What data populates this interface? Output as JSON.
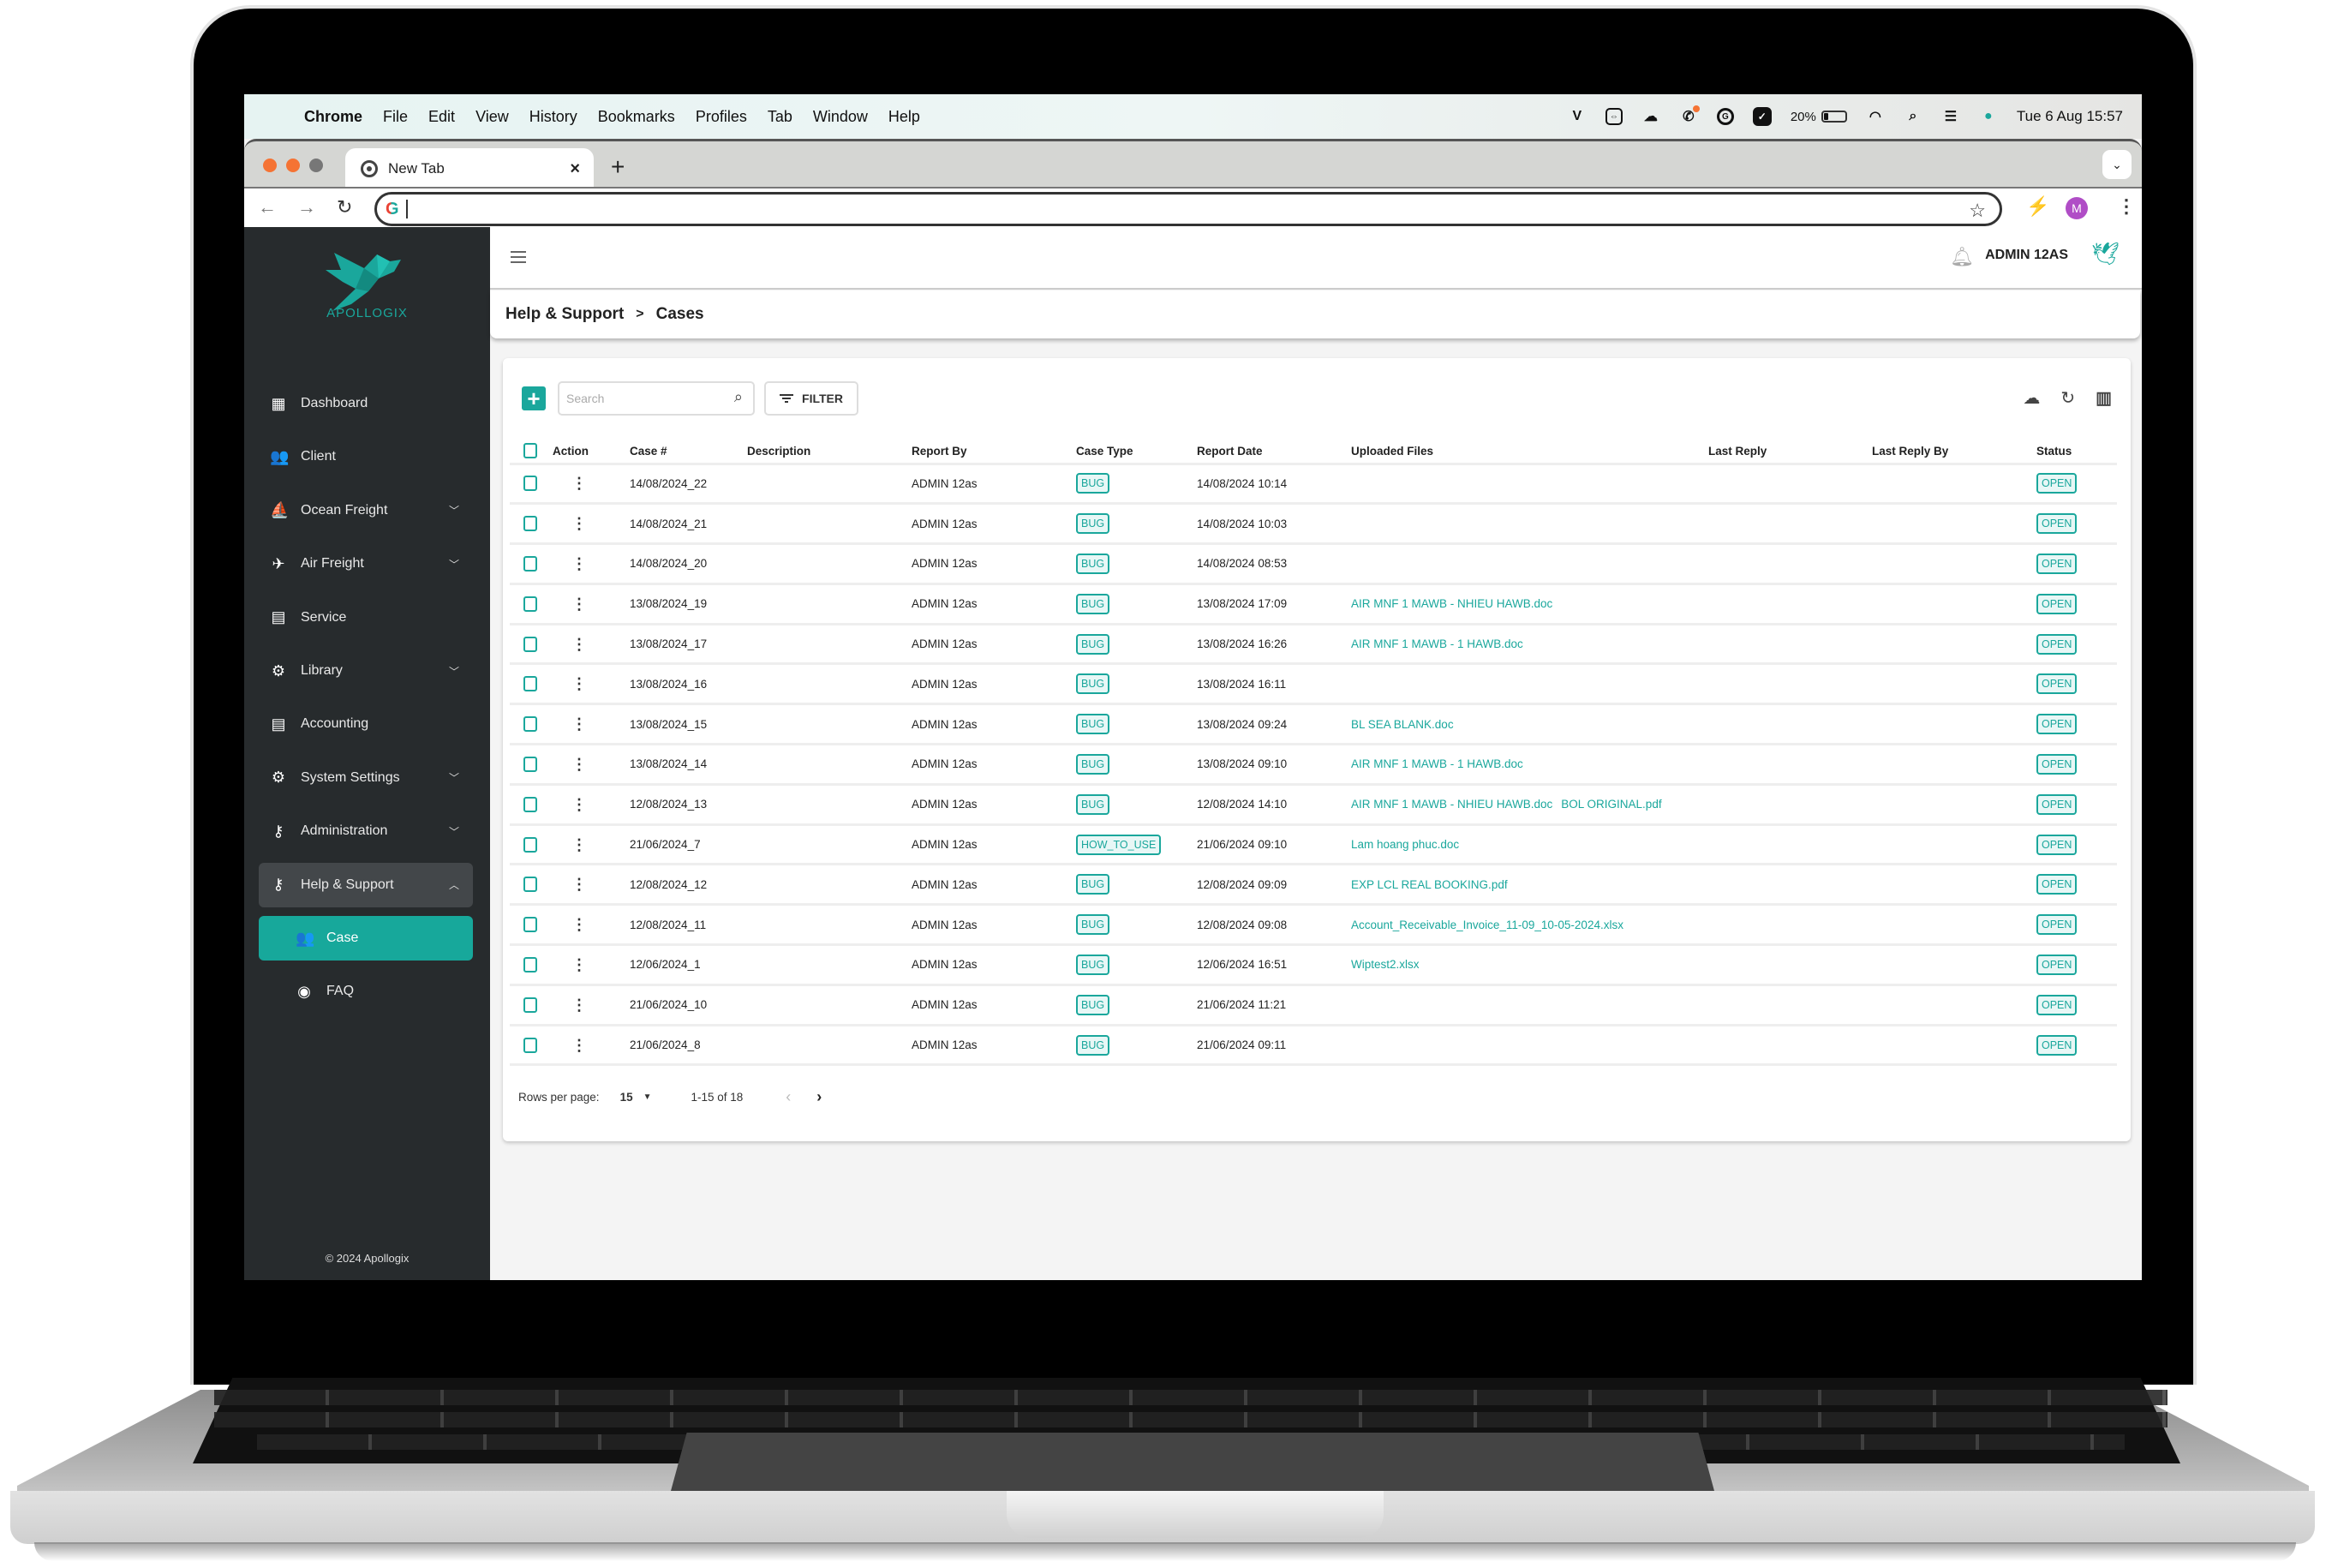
{
  "os_menubar": {
    "app": "Chrome",
    "items": [
      "File",
      "Edit",
      "View",
      "History",
      "Bookmarks",
      "Profiles",
      "Tab",
      "Window",
      "Help"
    ],
    "status_icons": [
      "vivaldi-icon",
      "teamviewer-icon",
      "cloud-sync-icon",
      "phone-notification-icon",
      "grammarly-icon",
      "checkbox-app-icon"
    ],
    "battery_percent": "20%",
    "battery_level": 0.2,
    "datetime": "Tue 6 Aug  15:57"
  },
  "browser": {
    "tab_title": "New Tab",
    "address_value": "",
    "profile_initial": "M",
    "colors": {
      "close": "#f57334",
      "minimize": "#f57334",
      "maximize": "#777777",
      "profile": "#b04dc6"
    }
  },
  "sidebar": {
    "brand": "APOLLOGIX",
    "items": [
      {
        "label": "Dashboard",
        "icon": "dashboard-icon",
        "glyph": "▦",
        "expandable": false
      },
      {
        "label": "Client",
        "icon": "people-icon",
        "glyph": "👥",
        "expandable": false
      },
      {
        "label": "Ocean Freight",
        "icon": "sailboat-icon",
        "glyph": "⛵",
        "expandable": true
      },
      {
        "label": "Air Freight",
        "icon": "airplane-icon",
        "glyph": "✈",
        "expandable": true
      },
      {
        "label": "Service",
        "icon": "list-icon",
        "glyph": "▤",
        "expandable": false
      },
      {
        "label": "Library",
        "icon": "gears-icon",
        "glyph": "⚙",
        "expandable": true
      },
      {
        "label": "Accounting",
        "icon": "list-icon",
        "glyph": "▤",
        "expandable": false
      },
      {
        "label": "System Settings",
        "icon": "gear-icon",
        "glyph": "⚙",
        "expandable": true
      },
      {
        "label": "Administration",
        "icon": "key-icon",
        "glyph": "⚷",
        "expandable": true
      },
      {
        "label": "Help & Support",
        "icon": "key-icon",
        "glyph": "⚷",
        "expandable": true,
        "expanded": true
      }
    ],
    "subitems": [
      {
        "label": "Case",
        "icon": "group-icon",
        "glyph": "👥",
        "active": true
      },
      {
        "label": "FAQ",
        "icon": "account-circle-icon",
        "glyph": "◉",
        "active": false
      }
    ],
    "copyright": "© 2024 Apollogix",
    "accent": "#17a89b"
  },
  "header": {
    "username": "ADMIN 12AS"
  },
  "breadcrumb": {
    "parent": "Help & Support",
    "separator": ">",
    "current": "Cases"
  },
  "toolbar": {
    "add_label": "+",
    "search_placeholder": "Search",
    "search_value": "",
    "filter_label": "FILTER"
  },
  "table": {
    "columns": [
      "",
      "Action",
      "Case #",
      "Description",
      "Report By",
      "Case Type",
      "Report Date",
      "Uploaded Files",
      "Last Reply",
      "Last Reply By",
      "Status"
    ],
    "rows": [
      {
        "case": "14/08/2024_22",
        "description": "",
        "report_by": "ADMIN 12as",
        "type": "BUG",
        "date": "14/08/2024 10:14",
        "files": [],
        "last_reply": "",
        "last_reply_by": "",
        "status": "OPEN"
      },
      {
        "case": "14/08/2024_21",
        "description": "",
        "report_by": "ADMIN 12as",
        "type": "BUG",
        "date": "14/08/2024 10:03",
        "files": [],
        "last_reply": "",
        "last_reply_by": "",
        "status": "OPEN"
      },
      {
        "case": "14/08/2024_20",
        "description": "",
        "report_by": "ADMIN 12as",
        "type": "BUG",
        "date": "14/08/2024 08:53",
        "files": [],
        "last_reply": "",
        "last_reply_by": "",
        "status": "OPEN"
      },
      {
        "case": "13/08/2024_19",
        "description": "",
        "report_by": "ADMIN 12as",
        "type": "BUG",
        "date": "13/08/2024 17:09",
        "files": [
          "AIR MNF 1 MAWB - NHIEU HAWB.doc"
        ],
        "last_reply": "",
        "last_reply_by": "",
        "status": "OPEN"
      },
      {
        "case": "13/08/2024_17",
        "description": "",
        "report_by": "ADMIN 12as",
        "type": "BUG",
        "date": "13/08/2024 16:26",
        "files": [
          "AIR MNF 1 MAWB - 1 HAWB.doc"
        ],
        "last_reply": "",
        "last_reply_by": "",
        "status": "OPEN"
      },
      {
        "case": "13/08/2024_16",
        "description": "",
        "report_by": "ADMIN 12as",
        "type": "BUG",
        "date": "13/08/2024 16:11",
        "files": [],
        "last_reply": "",
        "last_reply_by": "",
        "status": "OPEN"
      },
      {
        "case": "13/08/2024_15",
        "description": "",
        "report_by": "ADMIN 12as",
        "type": "BUG",
        "date": "13/08/2024 09:24",
        "files": [
          "BL SEA BLANK.doc"
        ],
        "last_reply": "",
        "last_reply_by": "",
        "status": "OPEN"
      },
      {
        "case": "13/08/2024_14",
        "description": "",
        "report_by": "ADMIN 12as",
        "type": "BUG",
        "date": "13/08/2024 09:10",
        "files": [
          "AIR MNF 1 MAWB - 1 HAWB.doc"
        ],
        "last_reply": "",
        "last_reply_by": "",
        "status": "OPEN"
      },
      {
        "case": "12/08/2024_13",
        "description": "",
        "report_by": "ADMIN 12as",
        "type": "BUG",
        "date": "12/08/2024 14:10",
        "files": [
          "AIR MNF 1 MAWB - NHIEU HAWB.doc",
          "BOL ORIGINAL.pdf"
        ],
        "last_reply": "",
        "last_reply_by": "",
        "status": "OPEN"
      },
      {
        "case": "21/06/2024_7",
        "description": "",
        "report_by": "ADMIN 12as",
        "type": "HOW_TO_USE",
        "date": "21/06/2024 09:10",
        "files": [
          "Lam hoang phuc.doc"
        ],
        "last_reply": "",
        "last_reply_by": "",
        "status": "OPEN"
      },
      {
        "case": "12/08/2024_12",
        "description": "",
        "report_by": "ADMIN 12as",
        "type": "BUG",
        "date": "12/08/2024 09:09",
        "files": [
          "EXP LCL REAL BOOKING.pdf"
        ],
        "last_reply": "",
        "last_reply_by": "",
        "status": "OPEN"
      },
      {
        "case": "12/08/2024_11",
        "description": "",
        "report_by": "ADMIN 12as",
        "type": "BUG",
        "date": "12/08/2024 09:08",
        "files": [
          "Account_Receivable_Invoice_11-09_10-05-2024.xlsx"
        ],
        "last_reply": "",
        "last_reply_by": "",
        "status": "OPEN"
      },
      {
        "case": "12/06/2024_1",
        "description": "",
        "report_by": "ADMIN 12as",
        "type": "BUG",
        "date": "12/06/2024 16:51",
        "files": [
          "Wiptest2.xlsx"
        ],
        "last_reply": "",
        "last_reply_by": "",
        "status": "OPEN"
      },
      {
        "case": "21/06/2024_10",
        "description": "",
        "report_by": "ADMIN 12as",
        "type": "BUG",
        "date": "21/06/2024 11:21",
        "files": [],
        "last_reply": "",
        "last_reply_by": "",
        "status": "OPEN"
      },
      {
        "case": "21/06/2024_8",
        "description": "",
        "report_by": "ADMIN 12as",
        "type": "BUG",
        "date": "21/06/2024 09:11",
        "files": [],
        "last_reply": "",
        "last_reply_by": "",
        "status": "OPEN"
      }
    ]
  },
  "pagination": {
    "rows_per_page_label": "Rows per page:",
    "rows_per_page": "15",
    "range": "1-15 of 18",
    "prev": "‹",
    "next": "›"
  }
}
